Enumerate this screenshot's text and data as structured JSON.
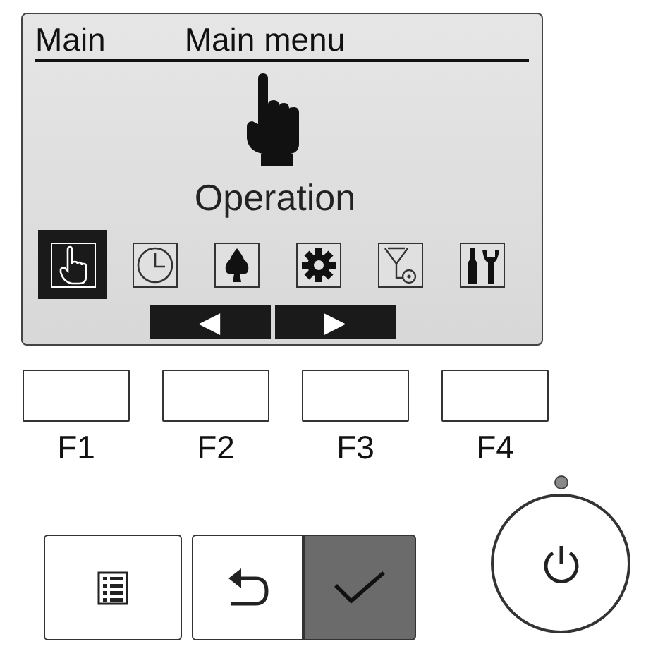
{
  "screen": {
    "header_left": "Main",
    "title": "Main menu",
    "current_label": "Operation",
    "menu_icons": [
      {
        "kind": "hand",
        "selected": true
      },
      {
        "kind": "clock",
        "selected": false
      },
      {
        "kind": "tree",
        "selected": false
      },
      {
        "kind": "gear",
        "selected": false
      },
      {
        "kind": "filter",
        "selected": false
      },
      {
        "kind": "tools",
        "selected": false
      }
    ],
    "nav": [
      "◀",
      "▶"
    ]
  },
  "function_keys": [
    "F1",
    "F2",
    "F3",
    "F4"
  ],
  "buttons": [
    {
      "kind": "menu"
    },
    {
      "kind": "back"
    },
    {
      "kind": "confirm"
    }
  ],
  "power_button": {
    "kind": "power"
  }
}
